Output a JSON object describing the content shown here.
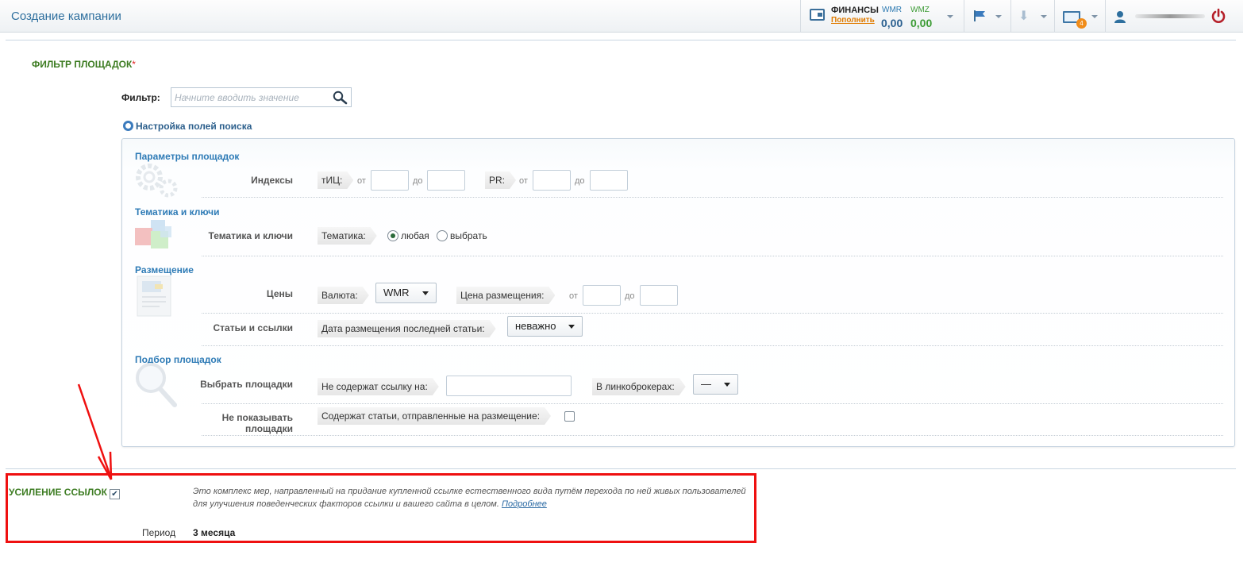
{
  "header": {
    "title": "Создание кампании",
    "finance_label": "ФИНАНСЫ",
    "finance_link": "Пополнить",
    "wmr_label": "WMR",
    "wmr_value": "0,00",
    "wmz_label": "WMZ",
    "wmz_value": "0,00",
    "mail_count": "4",
    "icons": [
      "wallet-icon",
      "flag-icon",
      "download-icon",
      "mail-icon",
      "user-icon",
      "power-icon"
    ]
  },
  "filter": {
    "title": "ФИЛЬТР ПЛОЩАДОК",
    "required_mark": "*",
    "filter_label": "Фильтр:",
    "search_placeholder": "Начните вводить значение",
    "settings_link": "Настройка полей поиска"
  },
  "params": {
    "title": "Параметры площадок",
    "indexes_label": "Индексы",
    "tic_tag": "тИЦ:",
    "pr_tag": "PR:",
    "from": "от",
    "to": "до"
  },
  "topics": {
    "title": "Тематика и ключи",
    "row_label": "Тематика и ключи",
    "tag": "Тематика:",
    "option_any": "любая",
    "option_choose": "выбрать",
    "selected": "любая"
  },
  "placement": {
    "title": "Размещение",
    "prices_label": "Цены",
    "currency_tag": "Валюта:",
    "currency_value": "WMR",
    "price_tag": "Цена размещения:",
    "articles_label": "Статьи и ссылки",
    "date_tag": "Дата размещения последней статьи:",
    "date_value": "неважно"
  },
  "selection": {
    "title": "Подбор площадок",
    "choose_label": "Выбрать площадки",
    "no_link_tag": "Не содержат ссылку на:",
    "brokers_tag": "В линкоброкерах:",
    "brokers_value": "—",
    "hide_label": "Не показывать площадки",
    "articles_sent_tag": "Содержат статьи, отправленные на размещение:"
  },
  "boost": {
    "title": "УСИЛЕНИЕ ССЫЛОК",
    "checked": true,
    "check_mark": "✔",
    "desc_line1": "Это комплекс мер, направленный на придание купленной ссылке естественного вида путём перехода по ней живых пользователей",
    "desc_line2": "для улучшения поведенческих факторов ссылки и вашего сайта в целом.",
    "more_link": "Подробнее",
    "period_label": "Период",
    "period_value": "3 месяца"
  },
  "colors": {
    "accent": "#2e7bb6",
    "section_title": "#3d7c22",
    "highlight": "#ef1010",
    "link_orange": "#e07b00"
  }
}
